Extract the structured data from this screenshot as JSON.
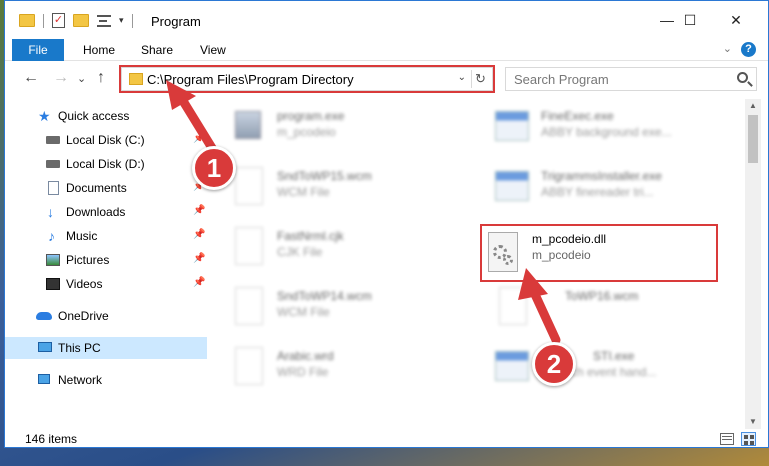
{
  "window": {
    "title": "Program",
    "minimize_glyph": "—",
    "maximize_glyph": "☐",
    "close_glyph": "✕"
  },
  "ribbon": {
    "tabs": [
      "File",
      "Home",
      "Share",
      "View"
    ]
  },
  "address_bar": {
    "path": "C:\\Program Files\\Program Directory"
  },
  "search": {
    "placeholder": "Search Program"
  },
  "sidebar": {
    "items": [
      {
        "label": "Quick access",
        "icon": "star-icon"
      },
      {
        "label": "Local Disk (C:)",
        "icon": "disk-icon"
      },
      {
        "label": "Local Disk (D:)",
        "icon": "disk-icon"
      },
      {
        "label": "Documents",
        "icon": "documents-icon"
      },
      {
        "label": "Downloads",
        "icon": "downloads-icon"
      },
      {
        "label": "Music",
        "icon": "music-icon"
      },
      {
        "label": "Pictures",
        "icon": "pictures-icon"
      },
      {
        "label": "Videos",
        "icon": "videos-icon"
      },
      {
        "label": "OneDrive",
        "icon": "onedrive-icon"
      },
      {
        "label": "This PC",
        "icon": "computer-icon"
      },
      {
        "label": "Network",
        "icon": "network-icon"
      }
    ]
  },
  "files": [
    {
      "name": "program.exe",
      "type": "m_pcodeio"
    },
    {
      "name": "FineExec.exe",
      "type": "ABBY background exe..."
    },
    {
      "name": "SndToWP15.wcm",
      "type": "WCM File"
    },
    {
      "name": "TrigrammsInstaller.exe",
      "type": "ABBY finereader tri..."
    },
    {
      "name": "FastNrml.cjk",
      "type": "CJK File"
    },
    {
      "name": "SndToWP14.wcm",
      "type": "WCM File"
    },
    {
      "name": "ToWP16.wcm",
      "type": ""
    },
    {
      "name": "Arabic.wrd",
      "type": "WRD File"
    },
    {
      "name": "STI.exe",
      "type": "ch event hand..."
    }
  ],
  "highlighted_file": {
    "name": "m_pcodeio.dll",
    "type": "m_pcodeio"
  },
  "annotations": {
    "step1": "1",
    "step2": "2",
    "color": "#d93a3a"
  },
  "status": {
    "item_count": "146 items"
  }
}
